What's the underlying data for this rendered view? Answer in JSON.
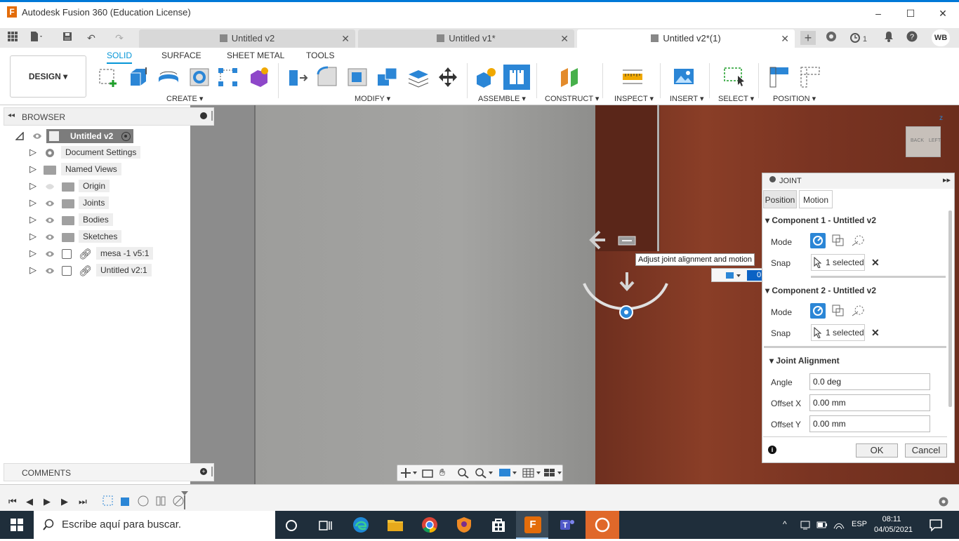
{
  "window": {
    "title": "Autodesk Fusion 360 (Education License)",
    "app_icon_letter": "F",
    "minimize": "–",
    "maximize": "☐",
    "close": "✕"
  },
  "tabs": [
    {
      "label": "Untitled v2",
      "active": false
    },
    {
      "label": "Untitled v1*",
      "active": false
    },
    {
      "label": "Untitled v2*(1)",
      "active": true
    }
  ],
  "top_right": {
    "job_count": "1",
    "user_initials": "WB"
  },
  "ribbon": {
    "workspace": "DESIGN ▾",
    "tabs": [
      "SOLID",
      "SURFACE",
      "SHEET METAL",
      "TOOLS"
    ],
    "groups": [
      "CREATE ▾",
      "MODIFY ▾",
      "ASSEMBLE ▾",
      "CONSTRUCT ▾",
      "INSPECT ▾",
      "INSERT ▾",
      "SELECT ▾",
      "POSITION ▾"
    ]
  },
  "browser": {
    "title": "BROWSER",
    "root": "Untitled v2",
    "items": [
      "Document Settings",
      "Named Views",
      "Origin",
      "Joints",
      "Bodies",
      "Sketches",
      "mesa -1 v5:1",
      "Untitled v2:1"
    ]
  },
  "comments": {
    "title": "COMMENTS"
  },
  "viewport": {
    "tooltip": "Adjust joint alignment and motion",
    "angle_input": "0.0 deg",
    "viewcube_back": "BACK",
    "viewcube_left": "LEFT"
  },
  "joint_panel": {
    "title": "JOINT",
    "tabs": [
      "Position",
      "Motion"
    ],
    "component1": "Component 1 - Untitled v2",
    "component2": "Component 2 - Untitled v2",
    "mode_label": "Mode",
    "snap_label": "Snap",
    "snap1_value": "1 selected",
    "snap2_value": "1 selected",
    "alignment_title": "Joint Alignment",
    "angle_label": "Angle",
    "angle_value": "0.0 deg",
    "offset_x_label": "Offset X",
    "offset_x_value": "0.00 mm",
    "offset_y_label": "Offset Y",
    "offset_y_value": "0.00 mm",
    "ok": "OK",
    "cancel": "Cancel"
  },
  "taskbar": {
    "search_placeholder": "Escribe aquí para buscar.",
    "language": "ESP",
    "time": "08:11",
    "date": "04/05/2021"
  }
}
